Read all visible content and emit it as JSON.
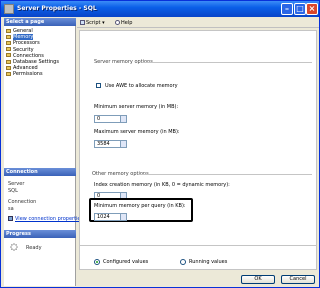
{
  "window": {
    "title": "Server Properties - SQL"
  },
  "left_pane": {
    "select_page_header": "Select a page",
    "pages": [
      {
        "label": "General",
        "selected": false
      },
      {
        "label": "Memory",
        "selected": true
      },
      {
        "label": "Processors",
        "selected": false
      },
      {
        "label": "Security",
        "selected": false
      },
      {
        "label": "Connections",
        "selected": false
      },
      {
        "label": "Database Settings",
        "selected": false
      },
      {
        "label": "Advanced",
        "selected": false
      },
      {
        "label": "Permissions",
        "selected": false
      }
    ],
    "connection_header": "Connection",
    "server_label": "Server",
    "server_value": "SQL",
    "connection_label": "Connection",
    "connection_value": "sa",
    "view_connection_link": "View connection properties",
    "progress_header": "Progress",
    "progress_status": "Ready"
  },
  "toolbar": {
    "script_label": "Script",
    "help_label": "Help"
  },
  "server_memory": {
    "group_label": "Server memory options",
    "awe_label": "Use AWE to allocate memory",
    "awe_checked": false,
    "min_label": "Minimum server memory (in MB):",
    "min_value": "0",
    "max_label": "Maximum server memory (in MB):",
    "max_value": "3584"
  },
  "other_memory": {
    "group_label": "Other memory options",
    "index_label": "Index creation memory (in KB, 0 = dynamic memory):",
    "index_value": "0",
    "min_query_label": "Minimum memory per query (in KB):",
    "min_query_value": "1024"
  },
  "values_mode": {
    "configured_label": "Configured values",
    "running_label": "Running values",
    "selected": "configured"
  },
  "buttons": {
    "ok": "OK",
    "cancel": "Cancel"
  }
}
